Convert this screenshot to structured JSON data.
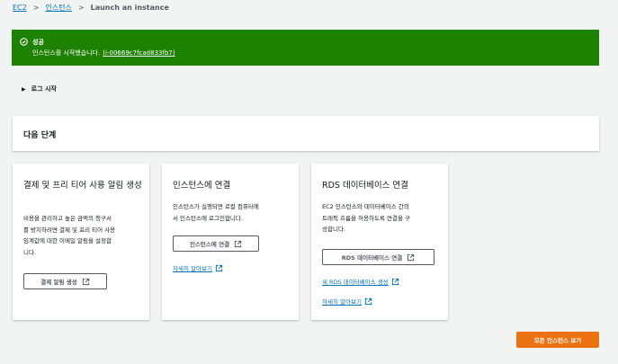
{
  "breadcrumb": {
    "items": [
      "EC2",
      "인스턴스"
    ],
    "current": "Launch an instance"
  },
  "flash": {
    "title": "성공",
    "message": "인스턴스를 시작했습니다.",
    "instance_link": "(i-00669c7fcad833fb7)"
  },
  "log_toggle": "로그 시작",
  "next_steps": {
    "title": "다음 단계"
  },
  "cards": [
    {
      "title": "결제 및 프리 티어 사용 알림 생성",
      "desc_lines": [
        "비용을 관리하고 높은 금액의 청구서",
        "를 방지하려면 결제 및 프리 티어 사용",
        "임계값에 대한 이메일 알림을 설정합",
        "니다."
      ],
      "button": "결제 알림 생성"
    },
    {
      "title": "인스턴스에 연결",
      "desc_lines": [
        "인스턴스가 실행되면 로컬 컴퓨터에",
        "서 인스턴스에 로그인합니다."
      ],
      "button": "인스턴스에 연결",
      "link": "자세히 알아보기"
    },
    {
      "title": "RDS 데이터베이스 연결",
      "desc_lines": [
        "EC2 인스턴스와 데이터베이스 간의",
        "트래픽 흐름을 허용하도록 연결을 구",
        "성합니다."
      ],
      "button": "RDS 데이터베이스 연결",
      "link1": "새 RDS 데이터베이스 생성",
      "link2": "자세히 알아보기"
    }
  ],
  "view_all_button": "모든 인스턴스 보기",
  "colors": {
    "success": "#1d8102",
    "primary": "#ec7211",
    "link": "#0073bb",
    "background": "#f2f3f3"
  }
}
